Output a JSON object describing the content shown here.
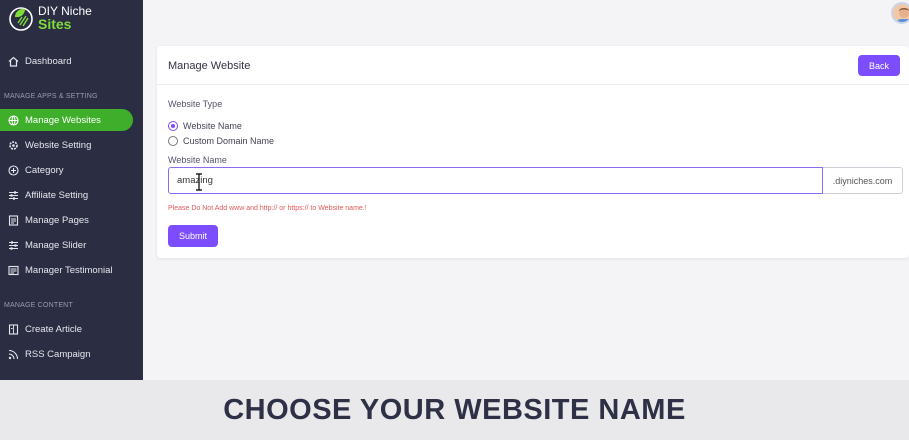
{
  "brand": {
    "line1": "DIY Niche",
    "line2": "Sites"
  },
  "sidebar": {
    "dashboard": "Dashboard",
    "section_apps": "MANAGE APPS & SETTING",
    "items": [
      {
        "label": "Manage Websites",
        "icon": "globe-icon",
        "active": true
      },
      {
        "label": "Website Setting",
        "icon": "gear-icon"
      },
      {
        "label": "Category",
        "icon": "plus-circle-icon"
      },
      {
        "label": "Affiliate Setting",
        "icon": "sliders-icon"
      },
      {
        "label": "Manage Pages",
        "icon": "page-icon"
      },
      {
        "label": "Manage Slider",
        "icon": "sliders-icon"
      },
      {
        "label": "Manager Testimonial",
        "icon": "testimonial-icon"
      }
    ],
    "section_content": "MANAGE CONTENT",
    "content_items": [
      {
        "label": "Create Article",
        "icon": "article-icon"
      },
      {
        "label": "RSS Campaign",
        "icon": "rss-icon"
      }
    ]
  },
  "card": {
    "title": "Manage Website",
    "back_label": "Back",
    "website_type_label": "Website Type",
    "radio_options": [
      "Website Name",
      "Custom Domain Name"
    ],
    "selected_option": "Website Name",
    "website_name_label": "Website Name",
    "website_name_value": "amazing",
    "domain_suffix": ".diyniches.com",
    "warning": "Please Do Not Add www and http:// or https:// to Website name.!",
    "submit_label": "Submit"
  },
  "caption": "CHOOSE YOUR WEBSITE NAME",
  "colors": {
    "sidebar_bg": "#2b2d42",
    "active_green": "#3fae2a",
    "accent_purple": "#7c4dff",
    "warning_red": "#e05a5a"
  }
}
